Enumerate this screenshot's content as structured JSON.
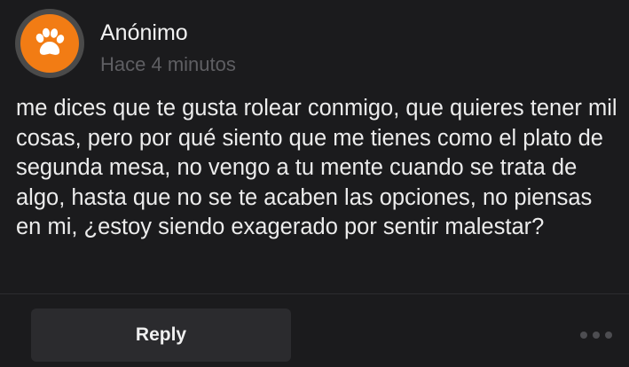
{
  "post": {
    "author": "Anónimo",
    "timestamp": "Hace 4 minutos",
    "message": "me dices que te gusta rolear conmigo, que quieres tener mil cosas, pero por qué siento que me tienes como el plato de segunda mesa, no vengo a tu mente cuando se trata de algo, hasta que no se te acaben las opciones, no piensas en mi, ¿estoy siendo exagerado por sentir malestar?",
    "avatar_icon": "paw-icon",
    "reply_label": "Reply",
    "more_icon": "more-options-icon"
  },
  "colors": {
    "background": "#1b1b1d",
    "avatar_orange": "#f27c14",
    "avatar_ring": "#4a4a4a",
    "button_bg": "#2b2b2e",
    "muted_text": "#5f5f63"
  }
}
